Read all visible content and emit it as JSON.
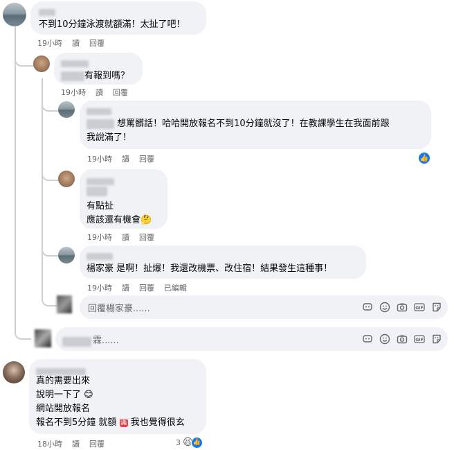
{
  "comments": [
    {
      "text": "不到10分鐘泳渡就額滿！太扯了吧！",
      "time": "19小時",
      "read": "讀",
      "reply": "回覆"
    },
    {
      "text": "有報到嗎？",
      "time": "19小時",
      "read": "讀",
      "reply": "回覆"
    },
    {
      "line1": "想罵髒話！哈哈開放報名不到10分鐘就沒了！在教課學生在我面前跟",
      "line2": "我說滿了！",
      "time": "19小時",
      "read": "讀",
      "reply": "回覆"
    },
    {
      "line1": "有點扯",
      "line2": "應該還有機會",
      "time": "19小時",
      "read": "讀",
      "reply": "回覆"
    },
    {
      "text": "楊家豪 是啊！扯爆！我還改機票、改住宿！結果發生這種事！",
      "time": "19小時",
      "read": "讀",
      "reply": "回覆",
      "edited": "已編輯"
    },
    {
      "line1": "真的需要出來",
      "line2": "說明一下了",
      "line3": "網站開放報名",
      "line4a": "報名不到5分鐘 就額",
      "line4b": "我也覺得很玄",
      "time": "18小時",
      "read": "讀",
      "reply": "回覆",
      "reactions": "3"
    }
  ],
  "reply_boxes": [
    {
      "placeholder": "回覆楊家豪......"
    },
    {
      "placeholder": "霖......"
    }
  ],
  "badge_char": "滿"
}
